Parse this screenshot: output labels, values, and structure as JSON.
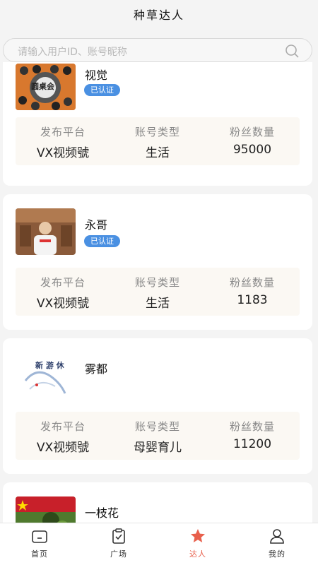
{
  "header": {
    "title": "种草达人"
  },
  "search": {
    "placeholder": "请输入用户ID、账号昵称"
  },
  "cards": [
    {
      "name": "视觉",
      "verified": "已认证",
      "avatar_text": "圆桌会",
      "stats": [
        {
          "label": "发布平台",
          "value": "VX视频號"
        },
        {
          "label": "账号类型",
          "value": "生活"
        },
        {
          "label": "粉丝数量",
          "value": "95000"
        }
      ]
    },
    {
      "name": "永哥",
      "verified": "已认证",
      "stats": [
        {
          "label": "发布平台",
          "value": "VX视频號"
        },
        {
          "label": "账号类型",
          "value": "生活"
        },
        {
          "label": "粉丝数量",
          "value": "1183"
        }
      ]
    },
    {
      "name": "雾都",
      "avatar_text": "新 游 休",
      "stats": [
        {
          "label": "发布平台",
          "value": "VX视频號"
        },
        {
          "label": "账号类型",
          "value": "母婴育儿"
        },
        {
          "label": "粉丝数量",
          "value": "11200"
        }
      ]
    },
    {
      "name": "一枝花"
    }
  ],
  "tabbar": [
    {
      "label": "首页",
      "icon": "home-icon"
    },
    {
      "label": "广场",
      "icon": "clipboard-check-icon"
    },
    {
      "label": "达人",
      "icon": "star-icon",
      "active": true
    },
    {
      "label": "我的",
      "icon": "user-icon"
    }
  ],
  "colors": {
    "accent": "#e8604c",
    "badge": "#4a90e2",
    "stats_bg": "#fbf8f3"
  }
}
